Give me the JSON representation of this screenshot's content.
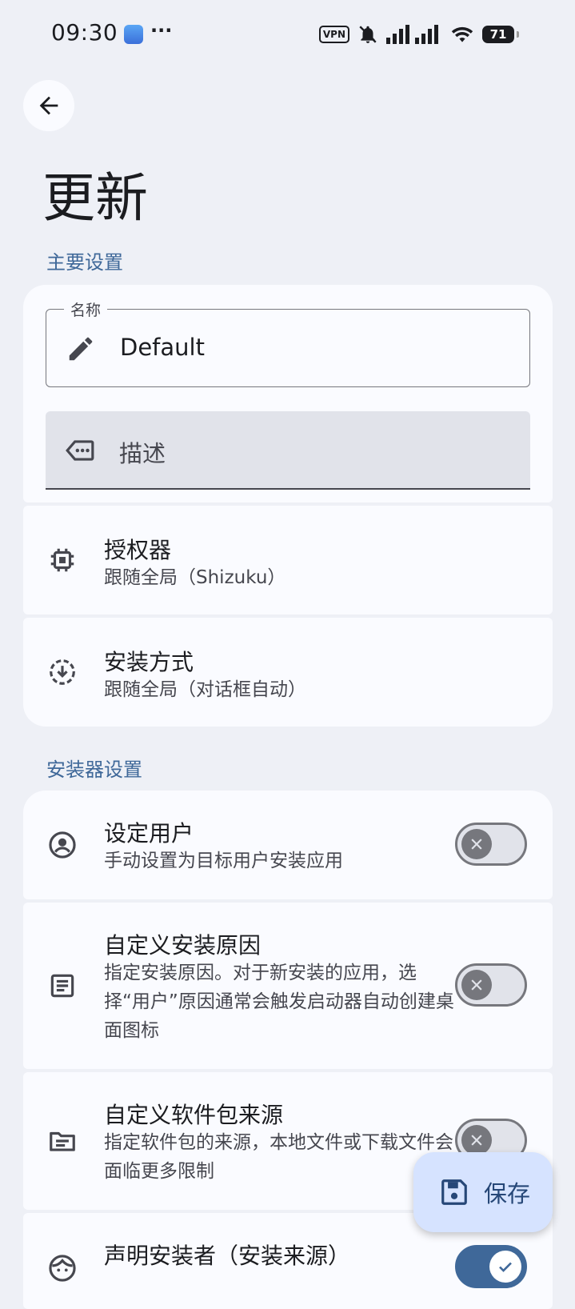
{
  "status_bar": {
    "time": "09:30",
    "dots": "···",
    "vpn": "VPN",
    "battery": "71"
  },
  "page": {
    "title": "更新"
  },
  "sections": {
    "main": "主要设置",
    "installer": "安装器设置"
  },
  "fields": {
    "name": {
      "label": "名称",
      "value": "Default"
    },
    "description": {
      "placeholder": "描述"
    }
  },
  "items": {
    "authorizer": {
      "title": "授权器",
      "subtitle": "跟随全局（Shizuku）"
    },
    "install_method": {
      "title": "安装方式",
      "subtitle": "跟随全局（对话框自动）"
    },
    "set_user": {
      "title": "设定用户",
      "subtitle": "手动设置为目标用户安装应用",
      "enabled": false
    },
    "custom_reason": {
      "title": "自定义安装原因",
      "subtitle": "指定安装原因。对于新安装的应用，选择“用户”原因通常会触发启动器自动创建桌面图标",
      "enabled": false
    },
    "custom_source": {
      "title": "自定义软件包来源",
      "subtitle": "指定软件包的来源，本地文件或下载文件会面临更多限制",
      "enabled": false
    },
    "declare_installer": {
      "title": "声明安装者（安装来源）",
      "enabled": true
    }
  },
  "fab": {
    "label": "保存"
  },
  "colors": {
    "background": "#eef0f6",
    "card": "#fafbff",
    "accent": "#3f6899",
    "fab": "#d6e3ff"
  }
}
